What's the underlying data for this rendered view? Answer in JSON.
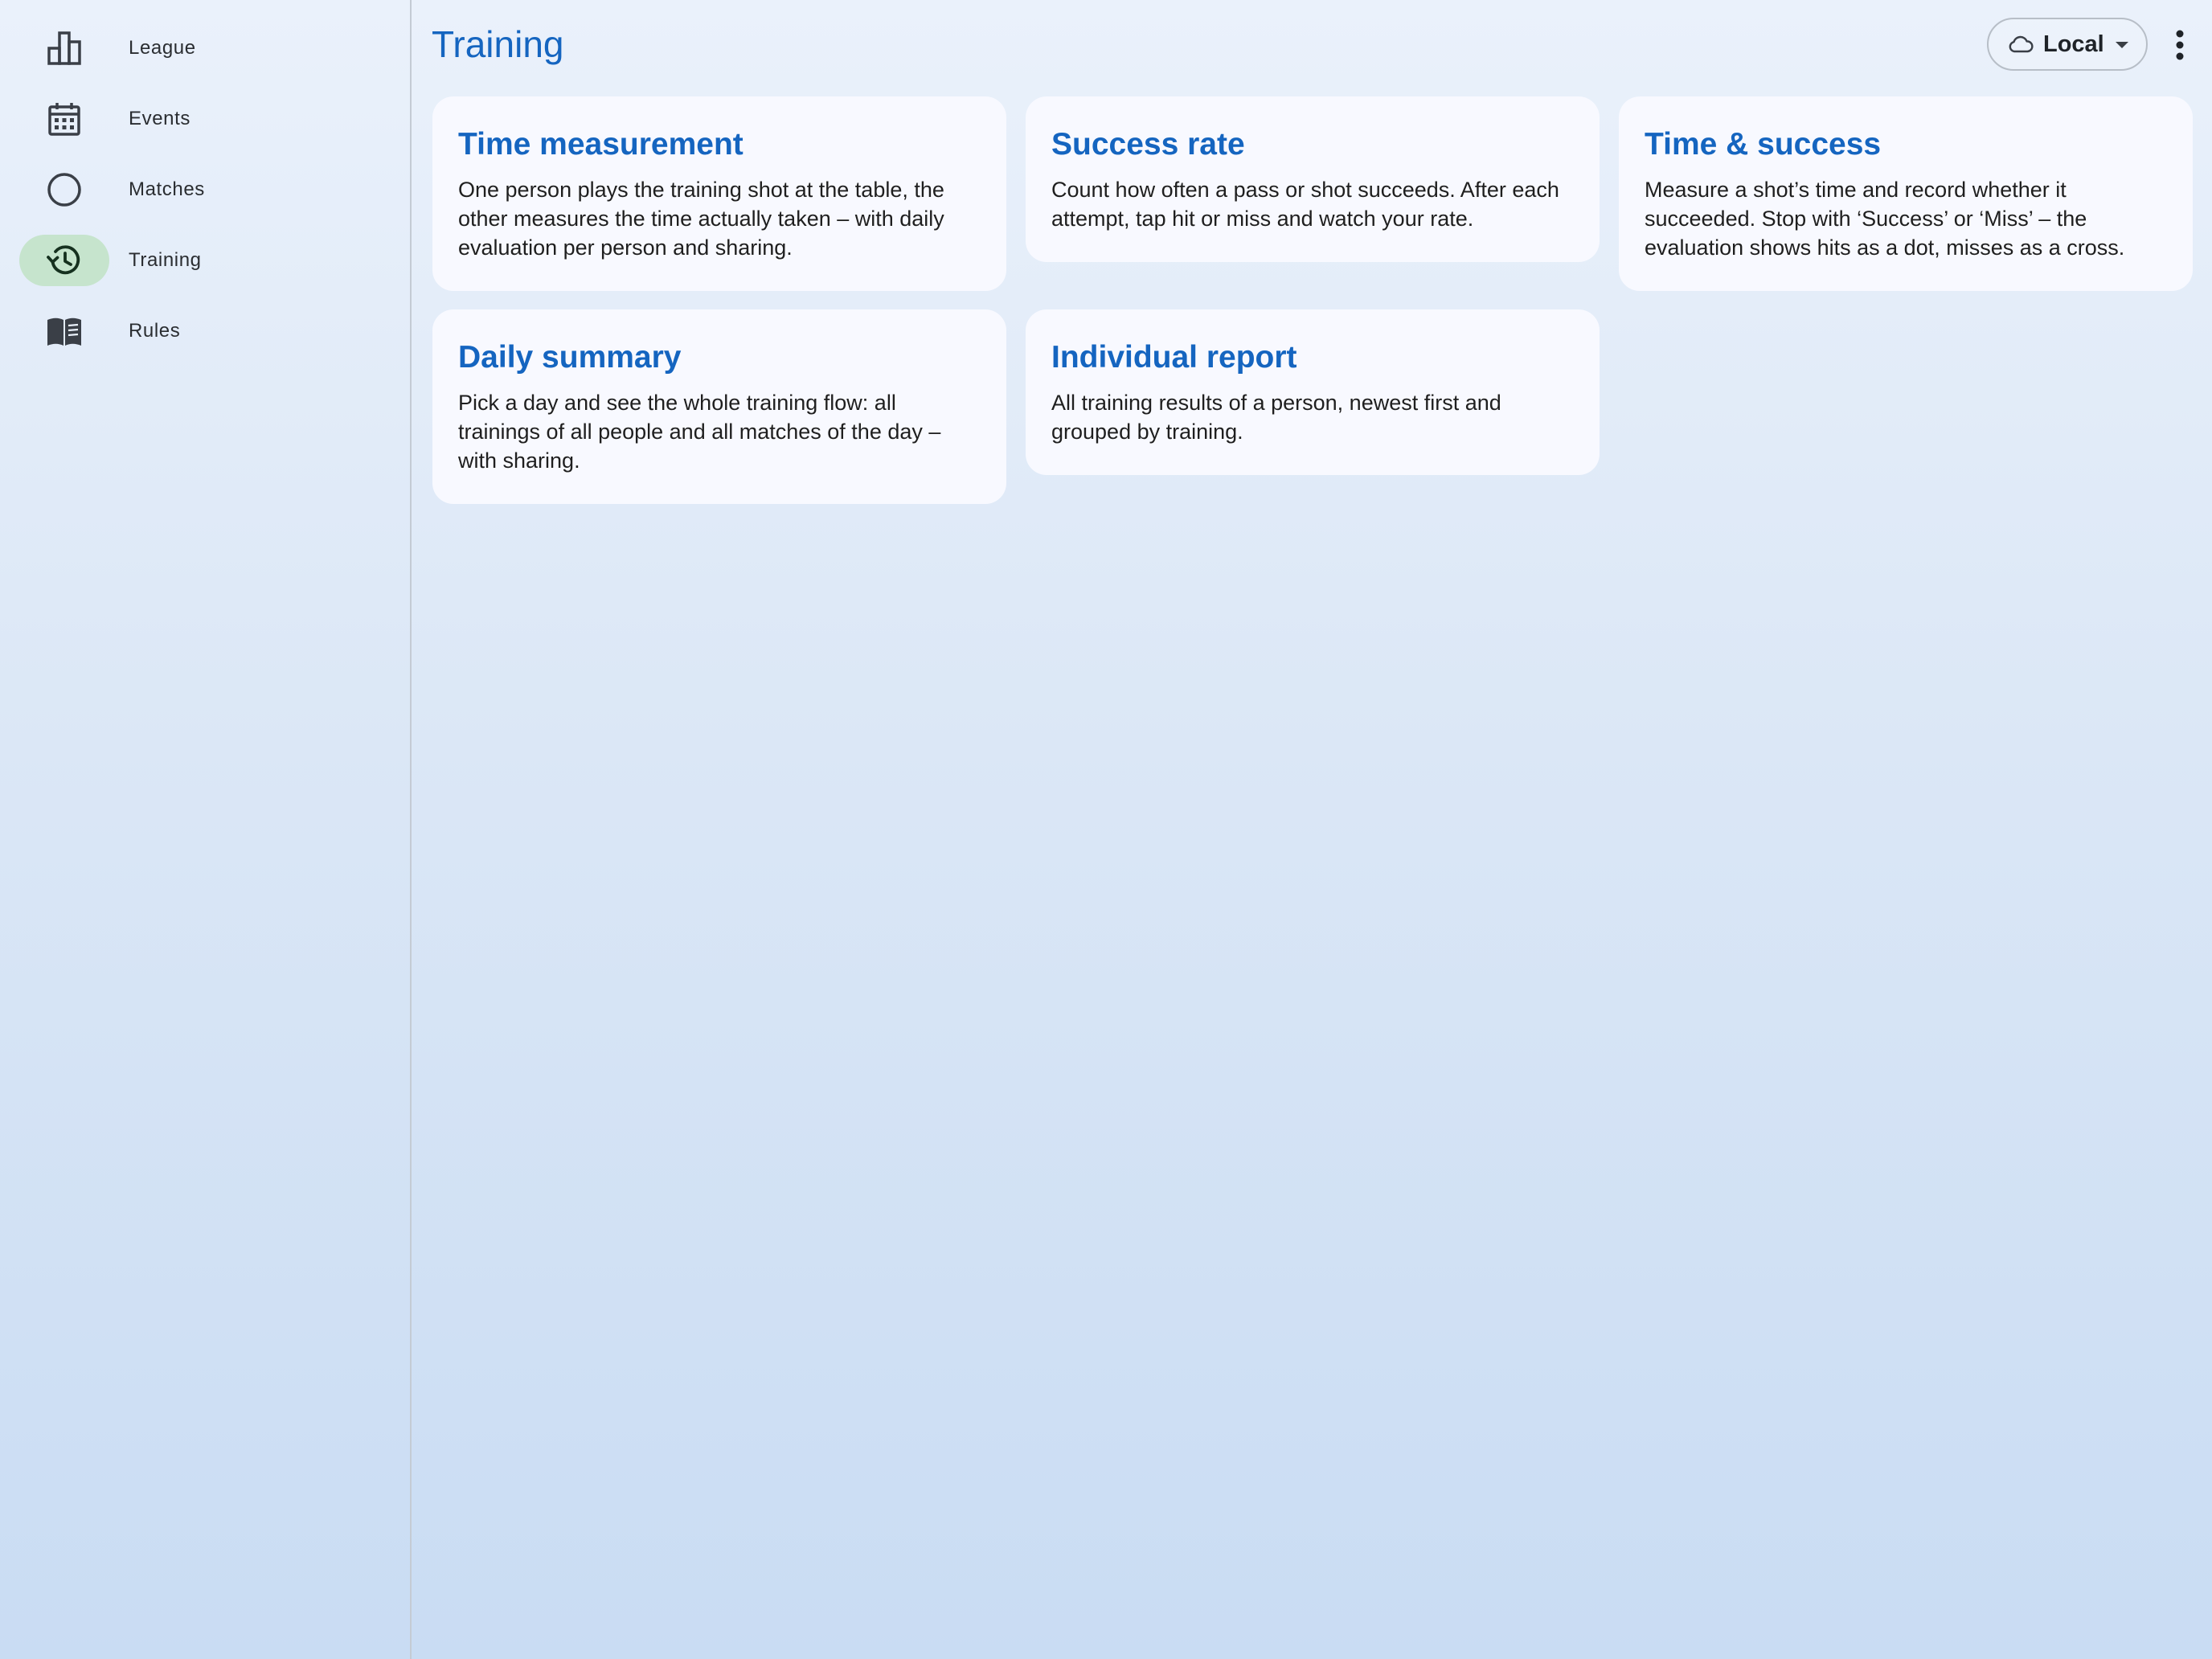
{
  "sidebar": {
    "items": [
      {
        "label": "League",
        "icon": "bar-chart-icon",
        "active": false
      },
      {
        "label": "Events",
        "icon": "calendar-icon",
        "active": false
      },
      {
        "label": "Matches",
        "icon": "circle-icon",
        "active": false
      },
      {
        "label": "Training",
        "icon": "history-icon",
        "active": true
      },
      {
        "label": "Rules",
        "icon": "book-icon",
        "active": false
      }
    ]
  },
  "header": {
    "title": "Training",
    "source_select": {
      "value": "Local",
      "icon": "cloud-icon"
    },
    "more_icon": "more-vert-icon"
  },
  "cards": [
    {
      "title": "Time measurement",
      "description": "One person plays the training shot at the table, the other measures the time actually taken – with daily evaluation per person and sharing."
    },
    {
      "title": "Success rate",
      "description": "Count how often a pass or shot succeeds. After each attempt, tap hit or miss and watch your rate."
    },
    {
      "title": "Time & success",
      "description": "Measure a shot’s time and record whether it succeeded. Stop with ‘Success’ or ‘Miss’ – the evaluation shows hits as a dot, misses as a cross."
    },
    {
      "title": "Daily summary",
      "description": "Pick a day and see the whole training flow: all trainings of all people and all matches of the day – with sharing."
    },
    {
      "title": "Individual report",
      "description": "All training results of a person, newest first and grouped by training."
    }
  ],
  "colors": {
    "accent": "#1565c0",
    "active_nav": "#c6e4cd",
    "card_bg": "#f8f9ff"
  }
}
